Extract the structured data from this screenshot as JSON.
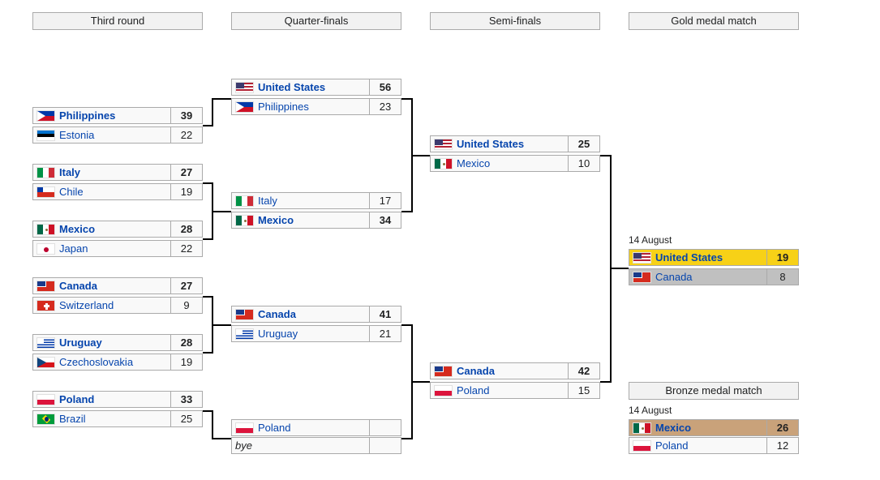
{
  "headers": {
    "round3": "Third round",
    "qf": "Quarter-finals",
    "sf": "Semi-finals",
    "gold": "Gold medal match",
    "bronze": "Bronze medal match"
  },
  "dates": {
    "gold": "14 August",
    "bronze": "14 August"
  },
  "round3": [
    {
      "team": "Philippines",
      "flag": "philippines-flag-icon",
      "score": "39"
    },
    {
      "team": "Estonia",
      "flag": "estonia-flag-icon",
      "score": "22"
    },
    {
      "team": "Italy",
      "flag": "italy-flag-icon",
      "score": "27"
    },
    {
      "team": "Chile",
      "flag": "chile-flag-icon",
      "score": "19"
    },
    {
      "team": "Mexico",
      "flag": "mexico-flag-icon",
      "score": "28"
    },
    {
      "team": "Japan",
      "flag": "japan-flag-icon",
      "score": "22"
    },
    {
      "team": "Canada",
      "flag": "canada-flag-icon",
      "score": "27"
    },
    {
      "team": "Switzerland",
      "flag": "switzerland-flag-icon",
      "score": "9"
    },
    {
      "team": "Uruguay",
      "flag": "uruguay-flag-icon",
      "score": "28"
    },
    {
      "team": "Czechoslovakia",
      "flag": "czechoslovakia-flag-icon",
      "score": "19"
    },
    {
      "team": "Poland",
      "flag": "poland-flag-icon",
      "score": "33"
    },
    {
      "team": "Brazil",
      "flag": "brazil-flag-icon",
      "score": "25"
    }
  ],
  "qf": [
    {
      "team": "United States",
      "flag": "united-states-flag-icon",
      "score": "56"
    },
    {
      "team": "Philippines",
      "flag": "philippines-flag-icon",
      "score": "23"
    },
    {
      "team": "Italy",
      "flag": "italy-flag-icon",
      "score": "17"
    },
    {
      "team": "Mexico",
      "flag": "mexico-flag-icon",
      "score": "34"
    },
    {
      "team": "Canada",
      "flag": "canada-flag-icon",
      "score": "41"
    },
    {
      "team": "Uruguay",
      "flag": "uruguay-flag-icon",
      "score": "21"
    },
    {
      "team": "Poland",
      "flag": "poland-flag-icon",
      "score": ""
    },
    {
      "team": "bye",
      "flag": "",
      "score": ""
    }
  ],
  "sf": [
    {
      "team": "United States",
      "flag": "united-states-flag-icon",
      "score": "25"
    },
    {
      "team": "Mexico",
      "flag": "mexico-flag-icon",
      "score": "10"
    },
    {
      "team": "Canada",
      "flag": "canada-flag-icon",
      "score": "42"
    },
    {
      "team": "Poland",
      "flag": "poland-flag-icon",
      "score": "15"
    }
  ],
  "gold": [
    {
      "team": "United States",
      "flag": "united-states-flag-icon",
      "score": "19"
    },
    {
      "team": "Canada",
      "flag": "canada-flag-icon",
      "score": "8"
    }
  ],
  "bronze": [
    {
      "team": "Mexico",
      "flag": "mexico-flag-icon",
      "score": "26"
    },
    {
      "team": "Poland",
      "flag": "poland-flag-icon",
      "score": "12"
    }
  ],
  "colors": {
    "gold": "#f7d117",
    "silver": "#c0c0c0",
    "bronze": "#c9a27a",
    "link": "#0645ad",
    "line": "#000000"
  }
}
